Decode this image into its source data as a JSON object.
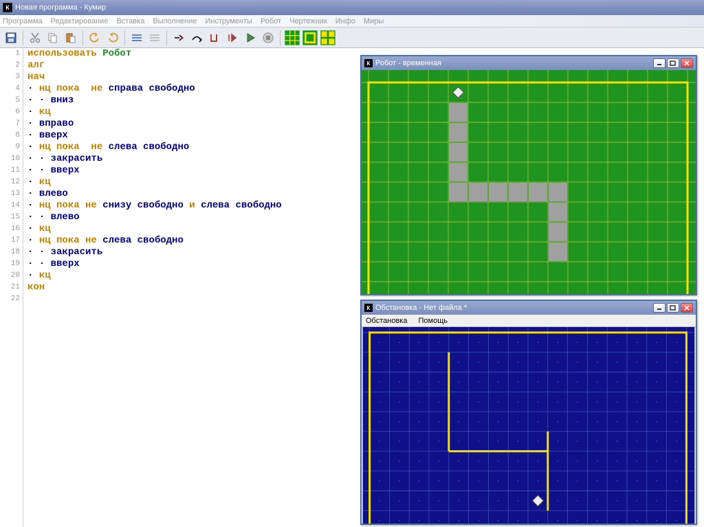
{
  "main_window": {
    "title": "Новая программа - Кумир",
    "menu": [
      "Программа",
      "Редактирование",
      "Вставка",
      "Выполнение",
      "Инструменты",
      "Робот",
      "Чертежник",
      "Инфо",
      "Миры"
    ]
  },
  "code": {
    "lines": [
      [
        {
          "t": "использовать ",
          "c": "kw"
        },
        {
          "t": "Робот",
          "c": "ident"
        }
      ],
      [
        {
          "t": "алг",
          "c": "kw"
        }
      ],
      [
        {
          "t": "нач",
          "c": "kw"
        }
      ],
      [
        {
          "t": "· ",
          "c": "dot"
        },
        {
          "t": "нц пока",
          "c": "kw"
        },
        {
          "t": "  не ",
          "c": "kw"
        },
        {
          "t": "справа свободно",
          "c": "kw2"
        }
      ],
      [
        {
          "t": "· · ",
          "c": "dot"
        },
        {
          "t": "вниз",
          "c": "kw2"
        }
      ],
      [
        {
          "t": "· ",
          "c": "dot"
        },
        {
          "t": "кц",
          "c": "kw"
        }
      ],
      [
        {
          "t": "· ",
          "c": "dot"
        },
        {
          "t": "вправо",
          "c": "kw2"
        }
      ],
      [
        {
          "t": "· ",
          "c": "dot"
        },
        {
          "t": "вверх",
          "c": "kw2"
        }
      ],
      [
        {
          "t": "· ",
          "c": "dot"
        },
        {
          "t": "нц пока",
          "c": "kw"
        },
        {
          "t": "  не ",
          "c": "kw"
        },
        {
          "t": "слева свободно",
          "c": "kw2"
        }
      ],
      [
        {
          "t": "· · ",
          "c": "dot"
        },
        {
          "t": "закрасить",
          "c": "kw2"
        }
      ],
      [
        {
          "t": "· · ",
          "c": "dot"
        },
        {
          "t": "вверх",
          "c": "kw2"
        }
      ],
      [
        {
          "t": "· ",
          "c": "dot"
        },
        {
          "t": "кц",
          "c": "kw"
        }
      ],
      [
        {
          "t": "· ",
          "c": "dot"
        },
        {
          "t": "влево",
          "c": "kw2"
        }
      ],
      [
        {
          "t": "· ",
          "c": "dot"
        },
        {
          "t": "нц пока не ",
          "c": "kw"
        },
        {
          "t": "снизу свободно",
          "c": "kw2"
        },
        {
          "t": " и ",
          "c": "kw"
        },
        {
          "t": "слева свободно",
          "c": "kw2"
        }
      ],
      [
        {
          "t": "· · ",
          "c": "dot"
        },
        {
          "t": "влево",
          "c": "kw2"
        }
      ],
      [
        {
          "t": "· ",
          "c": "dot"
        },
        {
          "t": "кц",
          "c": "kw"
        }
      ],
      [
        {
          "t": "· ",
          "c": "dot"
        },
        {
          "t": "нц пока не ",
          "c": "kw"
        },
        {
          "t": "слева свободно",
          "c": "kw2"
        }
      ],
      [
        {
          "t": "· · ",
          "c": "dot"
        },
        {
          "t": "закрасить",
          "c": "kw2"
        }
      ],
      [
        {
          "t": "· · ",
          "c": "dot"
        },
        {
          "t": "вверх",
          "c": "kw2"
        }
      ],
      [
        {
          "t": "· ",
          "c": "dot"
        },
        {
          "t": "кц",
          "c": "kw"
        }
      ],
      [
        {
          "t": "кон",
          "c": "kw"
        }
      ],
      [
        {
          "t": " ",
          "c": "dot"
        }
      ]
    ]
  },
  "robot_window": {
    "title": "Робот - временная",
    "grid": {
      "cols": 16,
      "rows": 11
    },
    "robot_pos": {
      "col": 4,
      "row": 0
    },
    "filled_cells": [
      {
        "col": 4,
        "row": 1
      },
      {
        "col": 4,
        "row": 2
      },
      {
        "col": 4,
        "row": 3
      },
      {
        "col": 4,
        "row": 4
      },
      {
        "col": 4,
        "row": 5
      },
      {
        "col": 5,
        "row": 5
      },
      {
        "col": 6,
        "row": 5
      },
      {
        "col": 7,
        "row": 5
      },
      {
        "col": 8,
        "row": 5
      },
      {
        "col": 9,
        "row": 5
      },
      {
        "col": 9,
        "row": 6
      },
      {
        "col": 9,
        "row": 7
      },
      {
        "col": 9,
        "row": 8
      }
    ]
  },
  "env_window": {
    "title": "Обстановка - Нет файла *",
    "menu": [
      "Обстановка",
      "Помощь"
    ],
    "grid": {
      "cols": 16,
      "rows": 10
    },
    "robot_pos": {
      "col": 8,
      "row": 8
    },
    "walls": [
      {
        "c": 4,
        "r": 1,
        "side": "left"
      },
      {
        "c": 4,
        "r": 2,
        "side": "left"
      },
      {
        "c": 4,
        "r": 3,
        "side": "left"
      },
      {
        "c": 4,
        "r": 4,
        "side": "left"
      },
      {
        "c": 4,
        "r": 5,
        "side": "left"
      },
      {
        "c": 4,
        "r": 5,
        "side": "bottom"
      },
      {
        "c": 5,
        "r": 5,
        "side": "bottom"
      },
      {
        "c": 6,
        "r": 5,
        "side": "bottom"
      },
      {
        "c": 7,
        "r": 5,
        "side": "bottom"
      },
      {
        "c": 8,
        "r": 5,
        "side": "bottom"
      },
      {
        "c": 9,
        "r": 5,
        "side": "left"
      },
      {
        "c": 9,
        "r": 6,
        "side": "left"
      },
      {
        "c": 9,
        "r": 7,
        "side": "left"
      },
      {
        "c": 9,
        "r": 8,
        "side": "left"
      }
    ]
  }
}
